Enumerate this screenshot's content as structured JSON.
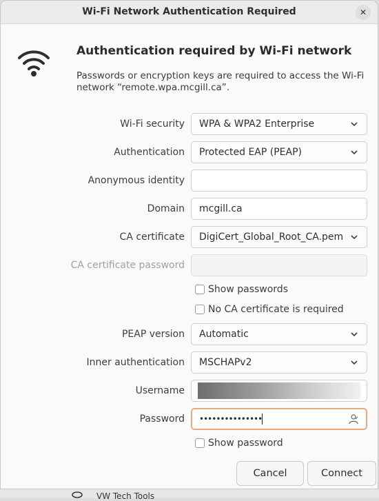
{
  "window": {
    "title": "Wi-Fi Network Authentication Required",
    "close_label": "✕"
  },
  "header": {
    "heading": "Authentication required by Wi-Fi network",
    "description": "Passwords or encryption keys are required to access the Wi-Fi network “remote.wpa.mcgill.ca”."
  },
  "form": {
    "wifi_security": {
      "label": "Wi-Fi security",
      "value": "WPA & WPA2 Enterprise"
    },
    "authentication": {
      "label": "Authentication",
      "value": "Protected EAP (PEAP)"
    },
    "anonymous_identity": {
      "label": "Anonymous identity",
      "value": ""
    },
    "domain": {
      "label": "Domain",
      "value": "mcgill.ca"
    },
    "ca_certificate": {
      "label": "CA certificate",
      "value": "DigiCert_Global_Root_CA.pem"
    },
    "ca_certificate_password": {
      "label": "CA certificate password",
      "value": ""
    },
    "show_passwords": {
      "label": "Show passwords",
      "checked": false
    },
    "no_ca_required": {
      "label": "No CA certificate is required",
      "checked": false
    },
    "peap_version": {
      "label": "PEAP version",
      "value": "Automatic"
    },
    "inner_authentication": {
      "label": "Inner authentication",
      "value": "MSCHAPv2"
    },
    "username": {
      "label": "Username",
      "value": ""
    },
    "password": {
      "label": "Password",
      "value": "•••••••••••••••"
    },
    "show_password": {
      "label": "Show password",
      "checked": false
    }
  },
  "buttons": {
    "cancel": "Cancel",
    "connect": "Connect"
  },
  "background": {
    "partial_text": "VW Tech Tools"
  },
  "colors": {
    "focus_border": "#e9a87c",
    "dialog_bg": "#fafafa",
    "titlebar_bg": "#ebebeb"
  },
  "icons": {
    "wifi": "wifi-icon",
    "chevron": "chevron-down-icon",
    "person": "person-icon",
    "close": "close-icon"
  }
}
